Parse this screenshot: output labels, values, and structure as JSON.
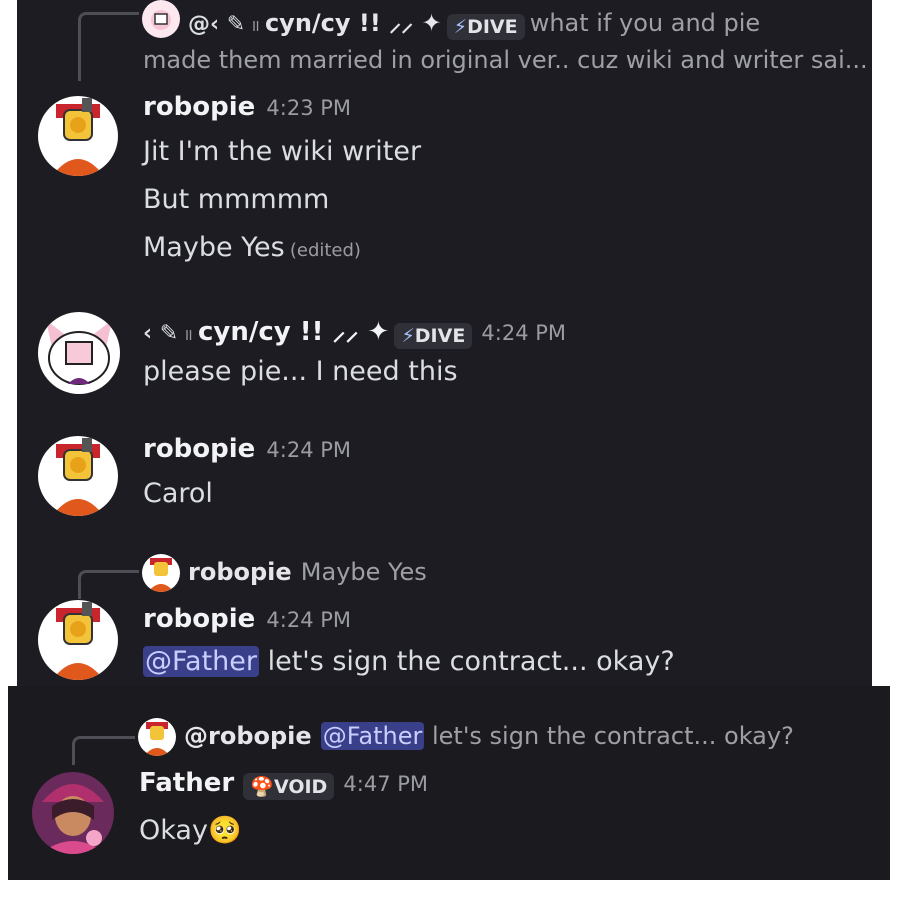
{
  "colors": {
    "background": "#1c1c22",
    "mention_bg": "#3a3f8a",
    "mention_text": "#c9ceff",
    "tag_bg": "#2f3038"
  },
  "messages": [
    {
      "reply": {
        "prefix": "@‹ ✎",
        "sep": "॥",
        "author": "cyn/cy !! ⸝⸝ ✦",
        "tag": "DIVE",
        "text_line1": "what if you and pie",
        "text_line2": "made them married in original ver.. cuz wiki and writer sai..."
      },
      "author": "robopie",
      "time": "4:23 PM",
      "lines": [
        "Jit I'm the wiki writer",
        "But mmmmm",
        "Maybe Yes"
      ],
      "edited": "(edited)"
    },
    {
      "author_prefix": "‹ ✎",
      "sep": "॥",
      "author": "cyn/cy  !! ⸝⸝ ✦",
      "tag": "DIVE",
      "time": "4:24 PM",
      "lines": [
        "please pie... I need this"
      ]
    },
    {
      "author": "robopie",
      "time": "4:24 PM",
      "lines": [
        "Carol"
      ]
    },
    {
      "reply": {
        "author": "robopie",
        "text": "Maybe Yes"
      },
      "author": "robopie",
      "time": "4:24 PM",
      "mention": "@Father",
      "text": " let's sign the contract... okay?"
    },
    {
      "reply": {
        "author": "@robopie",
        "mention": "@Father",
        "text": " let's sign the contract... okay?"
      },
      "author": "Father",
      "tag": "VOID",
      "time": "4:47 PM",
      "text": "Okay",
      "emoji": "🥺"
    }
  ]
}
